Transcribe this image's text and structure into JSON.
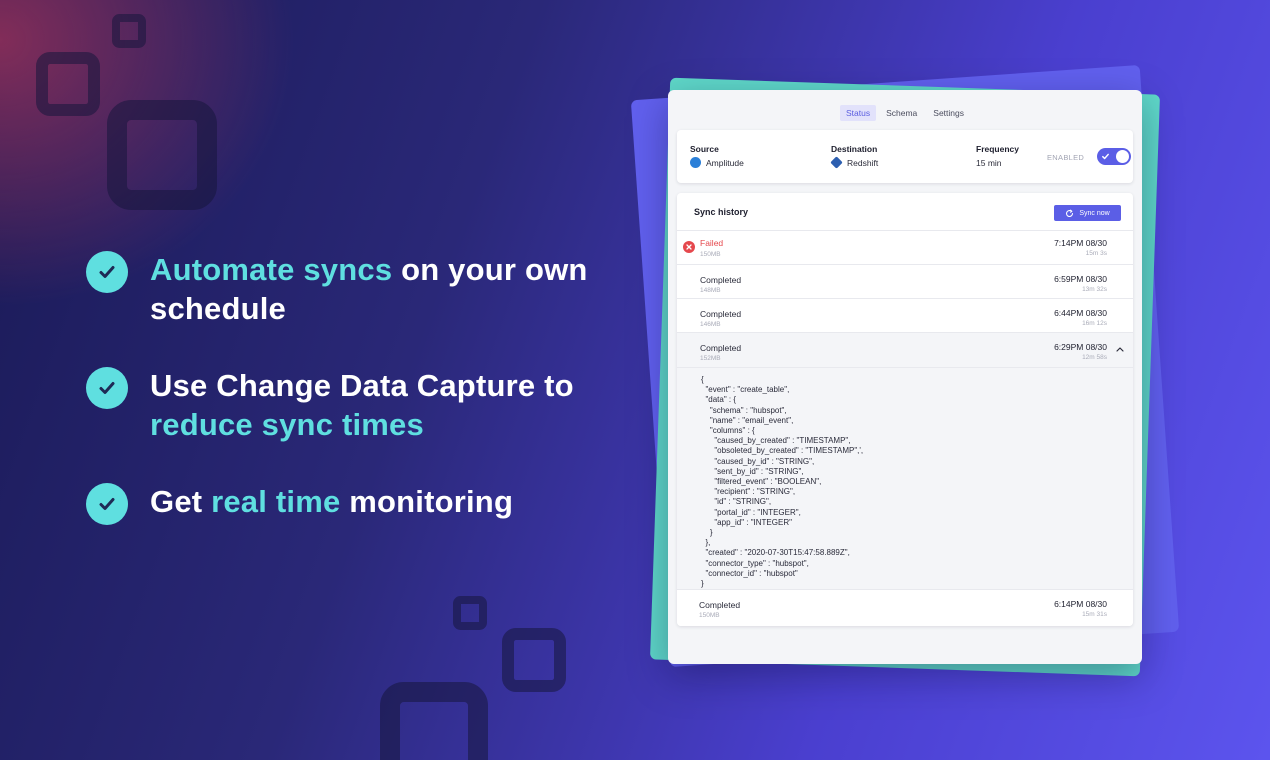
{
  "bullets": [
    {
      "parts": [
        {
          "text": "Automate syncs",
          "hl": true
        },
        {
          "text": " on your own schedule",
          "hl": false
        }
      ]
    },
    {
      "parts": [
        {
          "text": "Use Change Data Capture to ",
          "hl": false
        },
        {
          "text": "reduce sync times",
          "hl": true
        }
      ]
    },
    {
      "parts": [
        {
          "text": "Get ",
          "hl": false
        },
        {
          "text": "real time",
          "hl": true
        },
        {
          "text": " monitoring",
          "hl": false
        }
      ]
    }
  ],
  "tabs": [
    {
      "label": "Status",
      "active": true
    },
    {
      "label": "Schema",
      "active": false
    },
    {
      "label": "Settings",
      "active": false
    }
  ],
  "connection": {
    "source_label": "Source",
    "source_value": "Amplitude",
    "destination_label": "Destination",
    "destination_value": "Redshift",
    "frequency_label": "Frequency",
    "frequency_value": "15 min",
    "enabled_label": "ENABLED"
  },
  "history": {
    "title": "Sync history",
    "sync_button": "Sync now",
    "rows": [
      {
        "status": "Failed",
        "size": "150MB",
        "time": "7:14PM 08/30",
        "duration": "15m 3s",
        "failed": true
      },
      {
        "status": "Completed",
        "size": "148MB",
        "time": "6:59PM 08/30",
        "duration": "13m 32s",
        "failed": false
      },
      {
        "status": "Completed",
        "size": "146MB",
        "time": "6:44PM 08/30",
        "duration": "16m 12s",
        "failed": false
      },
      {
        "status": "Completed",
        "size": "152MB",
        "time": "6:29PM 08/30",
        "duration": "12m 58s",
        "failed": false
      },
      {
        "status": "Completed",
        "size": "150MB",
        "time": "6:14PM 08/30",
        "duration": "15m 31s",
        "failed": false
      }
    ],
    "json_lines": [
      "{",
      "  \"event\" : \"create_table\",",
      "  \"data\" : {",
      "    \"schema\" : \"hubspot\",",
      "    \"name\" : \"email_event\",",
      "    \"columns\" : {",
      "      \"caused_by_created\" : \"TIMESTAMP\",",
      "      \"obsoleted_by_created\" : \"TIMESTAMP\",',",
      "      \"caused_by_id\" : \"STRING\",",
      "      \"sent_by_id\" : \"STRING\",",
      "      \"filtered_event\" : \"BOOLEAN\",",
      "      \"recipient\" : \"STRING\",",
      "      \"id\" : \"STRING\",",
      "      \"portal_id\" : \"INTEGER\",",
      "      \"app_id\" : \"INTEGER\"",
      "    }",
      "  },",
      "  \"created\" : \"2020-07-30T15:47:58.889Z\",",
      "  \"connector_type\" : \"hubspot\",",
      "  \"connector_id\" : \"hubspot\"",
      "}"
    ]
  },
  "colors": {
    "accent": "#5b5ee6",
    "highlight": "#5fdfe0",
    "failed": "#e5484d"
  }
}
